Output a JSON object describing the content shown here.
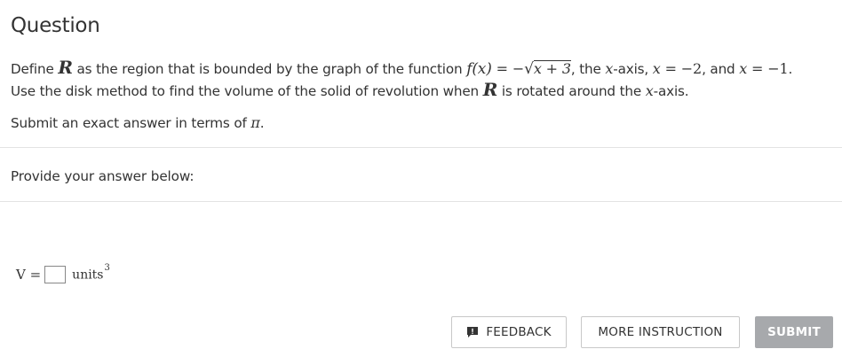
{
  "question": {
    "title": "Question",
    "line1": {
      "t1": "Define ",
      "R": "R",
      "t2": " as the region that is bounded by the graph of the function ",
      "fx": "f(x)",
      "eq": " = −",
      "sqrt_content": "x + 3",
      "t3": ", the ",
      "x1": "x",
      "t4": "-axis, ",
      "x2": "x",
      "eq2": " = −2",
      "t5": ", and ",
      "x3": "x",
      "eq3": " = −1",
      "t6": "."
    },
    "line2": {
      "t1": "Use the disk method to find the volume of the solid of revolution when ",
      "R": "R",
      "t2": " is rotated around the ",
      "x": "x",
      "t3": "-axis."
    },
    "line3": {
      "t1": "Submit an exact answer in terms of ",
      "pi": "π",
      "t2": "."
    }
  },
  "answer": {
    "prompt": "Provide your answer below:",
    "variable": "V =",
    "units": "units",
    "units_exp": "3",
    "value": ""
  },
  "buttons": {
    "feedback": "FEEDBACK",
    "more_instruction": "MORE INSTRUCTION",
    "submit": "SUBMIT"
  },
  "colors": {
    "text": "#333333",
    "divider": "#e3e3e3",
    "submit_bg": "#a7a9ac"
  }
}
